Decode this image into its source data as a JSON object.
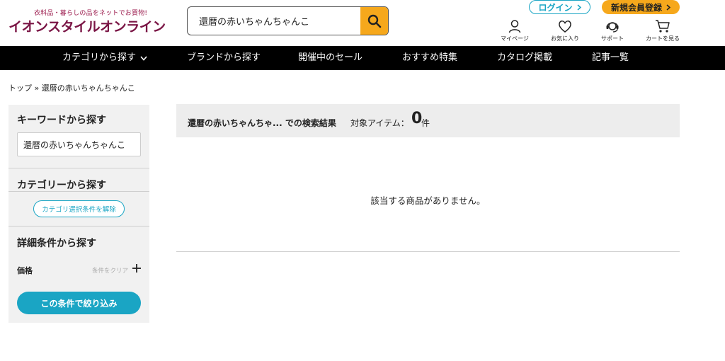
{
  "header": {
    "tagline": "衣料品・暮らしの品をネットでお買物!",
    "logo": "イオンスタイルオンライン",
    "search_value": "還暦の赤いちゃんちゃんこ",
    "login": "ログイン",
    "register": "新規会員登録",
    "utility": {
      "mypage": "マイページ",
      "favorites": "お気に入り",
      "support": "サポート",
      "cart": "カートを見る"
    }
  },
  "nav": {
    "items": [
      "カテゴリから探す",
      "ブランドから探す",
      "開催中のセール",
      "おすすめ特集",
      "カタログ掲載",
      "記事一覧"
    ]
  },
  "breadcrumb": "トップ » 還暦の赤いちゃんちゃんこ",
  "sidebar": {
    "keyword_heading": "キーワードから探す",
    "keyword_value": "還暦の赤いちゃんちゃんこ",
    "category_heading": "カテゴリーから探す",
    "category_clear": "カテゴリ選択条件を解除",
    "detail_heading": "詳細条件から探す",
    "price_label": "価格",
    "price_clear": "条件をクリア",
    "apply_button": "この条件で絞り込み"
  },
  "results": {
    "query_text": "還暦の赤いちゃんちゃ... での検索結果",
    "count_label": "対象アイテム：",
    "count": "0",
    "count_unit": "件",
    "no_results": "該当する商品がありません。"
  },
  "colors": {
    "accent_blue": "#1aa5c4",
    "accent_orange": "#f6a81c",
    "brand": "#7a1545"
  }
}
